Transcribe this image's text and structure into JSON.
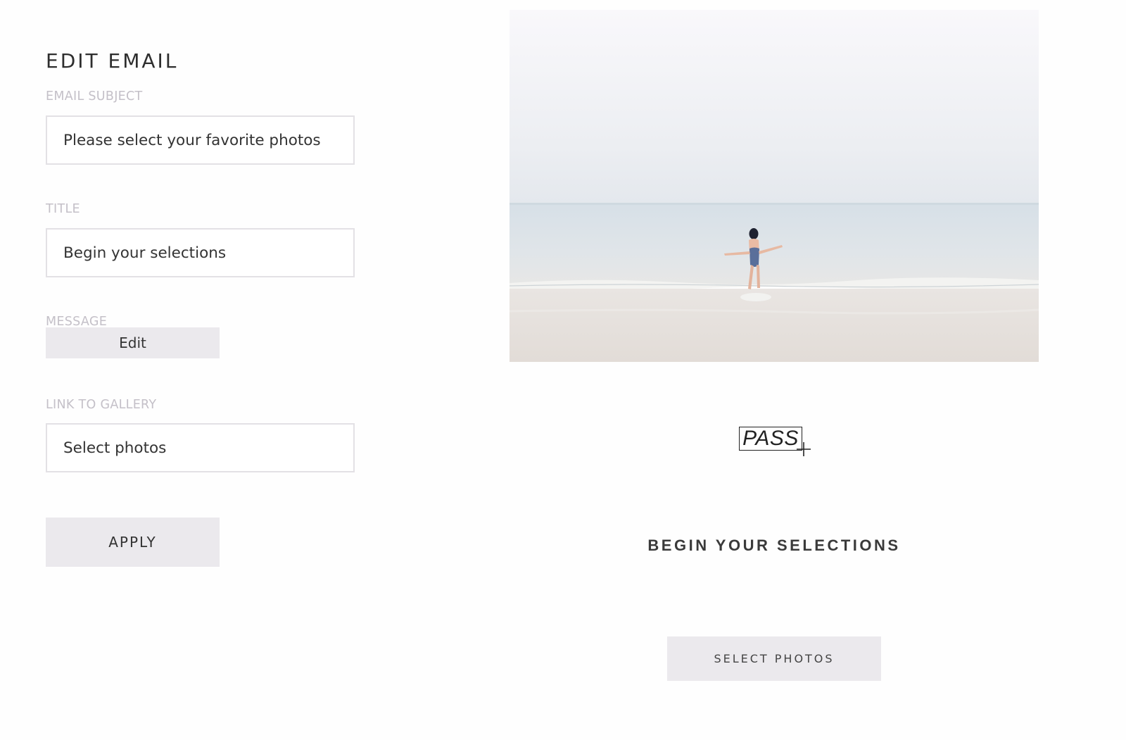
{
  "editor": {
    "title": "EDIT EMAIL",
    "subject": {
      "label": "EMAIL SUBJECT",
      "value": "Please select your favorite photos"
    },
    "title_field": {
      "label": "TITLE",
      "value": "Begin your selections"
    },
    "message": {
      "label": "MESSAGE",
      "edit_label": "Edit"
    },
    "gallery_link": {
      "label": "LINK TO GALLERY",
      "value": "Select photos"
    },
    "apply_label": "APPLY"
  },
  "preview": {
    "logo_text": "PASS",
    "logo_icon": "plus-icon",
    "heading": "BEGIN YOUR SELECTIONS",
    "button_label": "SELECT PHOTOS"
  },
  "colors": {
    "button_bg": "#ebe9ed",
    "label_gray": "#c4c0c8",
    "border": "#e3e1e5"
  }
}
